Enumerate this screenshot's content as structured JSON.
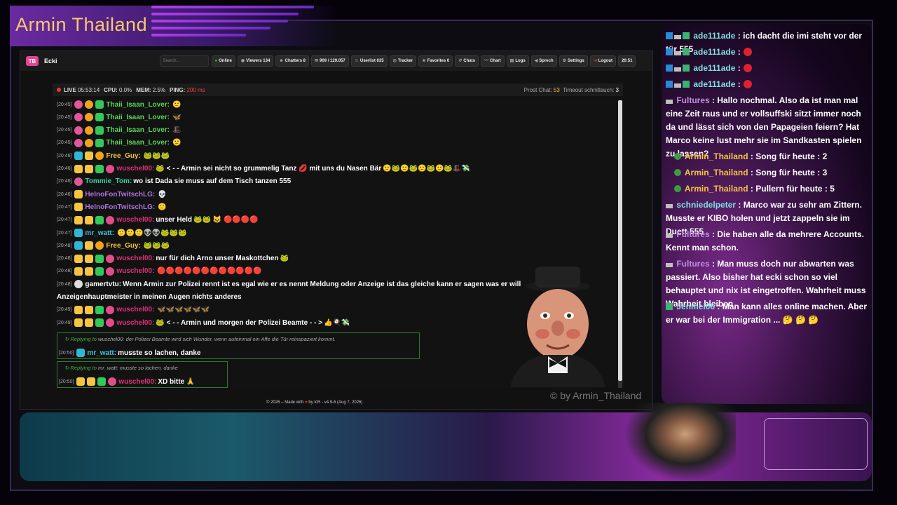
{
  "stream": {
    "title": "Armin Thailand",
    "watermark": "© by Armin_Thailand"
  },
  "toolbar": {
    "logo": "TB",
    "user": "Ecki",
    "search_placeholder": "Search...",
    "online": "Online",
    "viewers": "Viewers 134",
    "chatters": "Chatters 8",
    "messages": "909 / 129.057",
    "userlist": "Userlist 635",
    "tracker": "Tracker",
    "favorites": "Favorites 0",
    "chats": "Chats",
    "chart": "Chart",
    "logs": "Logs",
    "sprech": "Sprech",
    "settings": "Settings",
    "logout": "Logout",
    "clock": "20:51"
  },
  "status": {
    "live": "LIVE",
    "live_time": "05:53:14",
    "cpu_label": "CPU:",
    "cpu": "0.0%",
    "mem_label": "MEM:",
    "mem": "2.5%",
    "ping_label": "PING:",
    "ping": "200 ms",
    "prost_label": "Prost Chat:",
    "prost": "53",
    "timeout_label": "Timeout schnitlauch:",
    "timeout": "3"
  },
  "chat": [
    {
      "ts": "[20:45]",
      "name": "Thaii_Isaan_Lover:",
      "name_color": "#5ad35a",
      "text": "",
      "emotes": "🙂"
    },
    {
      "ts": "[20:45]",
      "name": "Thaii_Isaan_Lover:",
      "name_color": "#5ad35a",
      "text": "",
      "emotes": "🦋"
    },
    {
      "ts": "[20:45]",
      "name": "Thaii_Isaan_Lover:",
      "name_color": "#5ad35a",
      "text": "",
      "emotes": "🎩"
    },
    {
      "ts": "[20:45]",
      "name": "Thaii_Isaan_Lover:",
      "name_color": "#5ad35a",
      "text": "",
      "emotes": "🙂"
    },
    {
      "ts": "[20:46]",
      "name": "Free_Guy:",
      "name_color": "#f5c542",
      "text": "",
      "emotes": "🐸🐸🐸"
    },
    {
      "ts": "[20:46]",
      "name": "wuschel00:",
      "name_color": "#e0307a",
      "text": "🐸 < - - Armin sei nicht so grummelig Tanz 💋 mit uns du Nasen Bär",
      "emotes": "🙂🐸🙂🐸🙂🐸🙂🐸🎩💸"
    },
    {
      "ts": "[20:46]",
      "name": "Tommie_Tom:",
      "name_color": "#3ccfa0",
      "text": "wo ist Dada sie muss auf dem Tisch tanzen 555",
      "emotes": ""
    },
    {
      "ts": "[20:46]",
      "name": "HeInoFonTwitschLG:",
      "name_color": "#b070e0",
      "text": "",
      "emotes": "💀"
    },
    {
      "ts": "[20:47]",
      "name": "HeInoFonTwitschLG:",
      "name_color": "#b070e0",
      "text": "",
      "emotes": "🙂"
    },
    {
      "ts": "[20:47]",
      "name": "wuschel00:",
      "name_color": "#e0307a",
      "text": "unser Held",
      "emotes": "🐸🐸 😺 🔴🔴🔴🔴"
    },
    {
      "ts": "[20:47]",
      "name": "mr_watt:",
      "name_color": "#3cc6d6",
      "text": "",
      "emotes": "🙂🙂🙂👽👽🐸🐸🐸"
    },
    {
      "ts": "[20:48]",
      "name": "Free_Guy:",
      "name_color": "#f5c542",
      "text": "",
      "emotes": "🐸🐸🐸"
    },
    {
      "ts": "[20:48]",
      "name": "wuschel00:",
      "name_color": "#e0307a",
      "text": "nur für dich Arno unser Maskottchen",
      "emotes": "🐸"
    },
    {
      "ts": "[20:48]",
      "name": "wuschel00:",
      "name_color": "#e0307a",
      "text": "",
      "emotes": "🔴🔴🔴🔴🔴🔴🔴🔴🔴🔴🔴🔴"
    },
    {
      "ts": "[20:48]",
      "name": "gamertvtu:",
      "name_color": "#ffffff",
      "text": "Wenn Armin zur Polizei rennt ist es egal wie er es nennt Meldung oder Anzeige ist das gleiche kann er sagen was er will",
      "emotes": ""
    },
    {
      "ts": "",
      "name": "",
      "name_color": "#ffffff",
      "text": "Anzeigenhauptmeister in meinen Augen nichts anderes",
      "emotes": ""
    },
    {
      "ts": "[20:49]",
      "name": "wuschel00:",
      "name_color": "#e0307a",
      "text": "",
      "emotes": "🦋🦋🦋🦋🦋🦋"
    },
    {
      "ts": "[20:49]",
      "name": "wuschel00:",
      "name_color": "#e0307a",
      "text": "🐸 < - - Armin und morgen der Polizei Beamte - - >",
      "emotes": "👍🍳💸"
    }
  ],
  "replies": [
    {
      "label": "Replying to",
      "quote": "wuschel00: der Polizei Beamte wird sich Wunder, wenn aufeinmal ein Affe die Tür reinspaziert kommt.",
      "ts": "[20:50]",
      "name": "mr_watt:",
      "name_color": "#3cc6d6",
      "text": "musste so lachen, danke"
    },
    {
      "label": "Replying to",
      "quote": "mr_watt: musste so lachen, danke",
      "ts": "[20:50]",
      "name": "wuschel00:",
      "name_color": "#e0307a",
      "text": "XD bitte 🙏"
    }
  ],
  "footer": {
    "text_a": "© 2026 – Made with",
    "heart": "♥",
    "text_b": "by tcR - v4.9-6 (Aug 7, 2026)"
  },
  "overlay_chat": [
    {
      "name": "ade111ade",
      "text": ": ich dacht die imi steht vor der tür 555",
      "name_class": "c2",
      "badges": "abc",
      "red": false
    },
    {
      "name": "ade111ade",
      "text": ":",
      "name_class": "c2",
      "badges": "abc",
      "red": true
    },
    {
      "name": "ade111ade",
      "text": ":",
      "name_class": "c2",
      "badges": "abc",
      "red": true
    },
    {
      "name": "ade111ade",
      "text": ":",
      "name_class": "c2",
      "badges": "abc",
      "red": true
    },
    {
      "name": "Fultures",
      "text": ": Hallo nochmal. Also da ist man mal eine Zeit raus und er vollsuffski sitzt immer noch da und lässt sich von den Papageien feiern? Hat Marco keine lust mehr sie im Sandkasten spielen zu lassen?",
      "name_class": "p",
      "badges": "b",
      "red": false
    },
    {
      "name": "Armin_Thailand",
      "text": ": Song für heute : 2",
      "name_class": "y",
      "badges": "e",
      "red": false
    },
    {
      "name": "Armin_Thailand",
      "text": ": Song für heute : 3",
      "name_class": "y",
      "badges": "e",
      "red": false
    },
    {
      "name": "Armin_Thailand",
      "text": ": Pullern für heute : 5",
      "name_class": "y",
      "badges": "e",
      "red": false
    },
    {
      "name": "schniedelpeter",
      "text": ": Marco war zu sehr am Zittern. Musste er KIBO holen und jetzt zappeln sie im Duett 555",
      "name_class": "c2",
      "badges": "b",
      "red": false
    },
    {
      "name": "Fultures",
      "text": ": Die haben alle da mehrere Accounts. Kennt man schon.",
      "name_class": "p",
      "badges": "b",
      "red": false
    },
    {
      "name": "Fultures",
      "text": ": Man muss doch nur abwarten was passiert. Also bisher hat ecki schon so viel behauptet und nix ist eingetroffen. Wahrheit muss Wahrheit bleiben",
      "name_class": "p",
      "badges": "b",
      "red": false
    },
    {
      "name": "Jenmei06",
      "text": ": Man kann alles online machen. Aber er war bei der Immigration ... 🤔 🤔 🤔",
      "name_class": "c2",
      "badges": "c",
      "red": false
    }
  ],
  "colors": {
    "accent_purple": "#8a2aa0",
    "title_gold": "#f7c96b",
    "live_red": "#ee3333"
  }
}
